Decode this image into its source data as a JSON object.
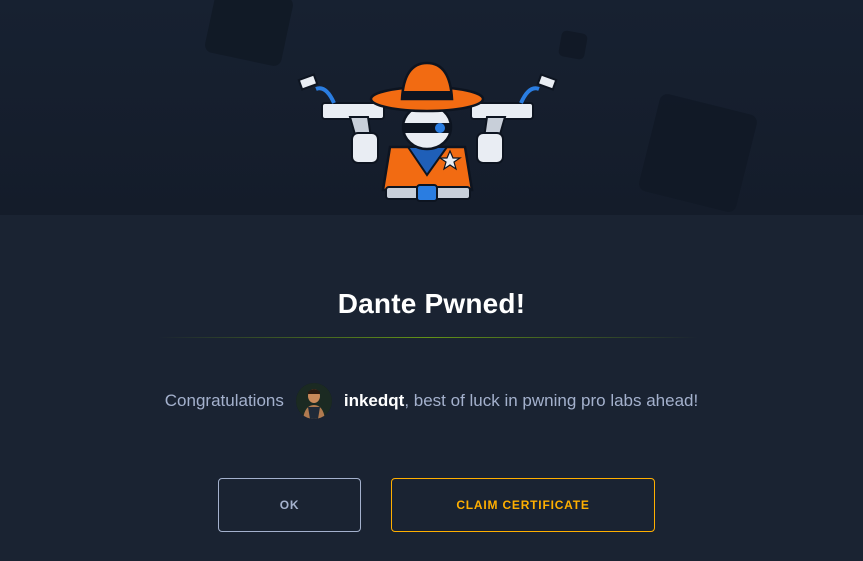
{
  "hero": {
    "image": "cowboy-mascot-icon"
  },
  "modal": {
    "title": "Dante Pwned!",
    "message_prefix": "Congratulations",
    "username": "inkedqt",
    "message_suffix": ", best of luck in pwning pro labs ahead!"
  },
  "buttons": {
    "ok_label": "OK",
    "claim_label": "CLAIM CERTIFICATE"
  },
  "colors": {
    "background": "#1a2332",
    "hero_background": "#151e2c",
    "title": "#ffffff",
    "message": "#a4b1cd",
    "accent_orange": "#ffaf00",
    "divider_green": "#9fef00"
  }
}
